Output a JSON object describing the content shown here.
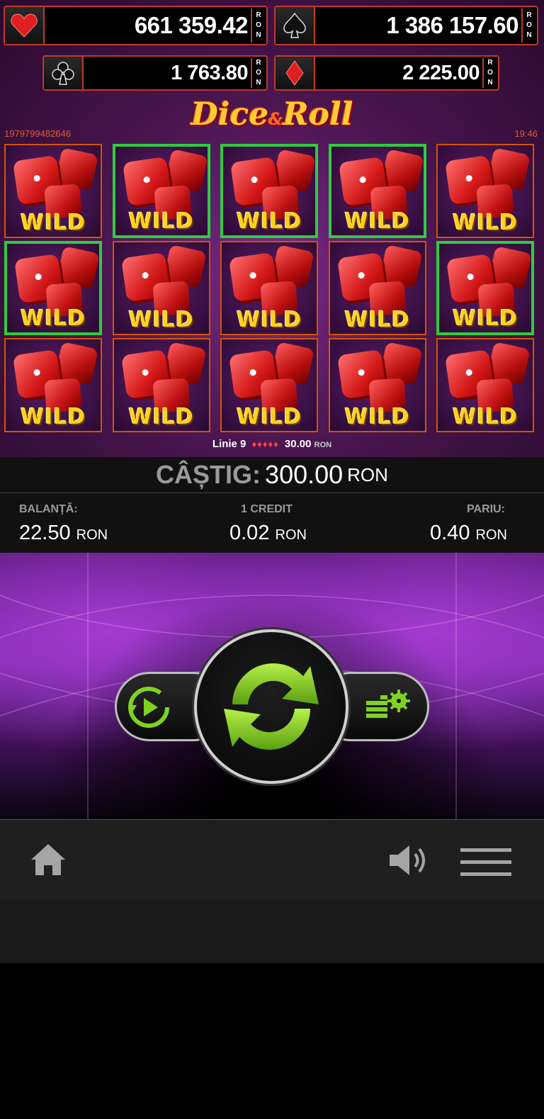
{
  "jackpots": [
    {
      "suit": "heart-icon",
      "amount": "661 359.42",
      "currency": "RON",
      "color": "#e02020"
    },
    {
      "suit": "spade-icon",
      "amount": "1 386 157.60",
      "currency": "RON",
      "color": "#111111"
    },
    {
      "suit": "club-icon",
      "amount": "1 763.80",
      "currency": "RON",
      "color": "#111111"
    },
    {
      "suit": "diamond-icon",
      "amount": "2 225.00",
      "currency": "RON",
      "color": "#e02020"
    }
  ],
  "game": {
    "title_part1": "Dice",
    "title_amp": "&",
    "title_part2": "Roll",
    "round_id": "1979799482646",
    "time": "19:46",
    "symbol_label": "WILD",
    "rows": 3,
    "columns": 5,
    "winning_cells": [
      [
        0,
        1
      ],
      [
        0,
        2
      ],
      [
        0,
        3
      ],
      [
        1,
        0
      ],
      [
        1,
        4
      ]
    ],
    "win_line": {
      "label": "Linie 9",
      "amount": "30.00",
      "currency": "RON",
      "symbol_count": 5
    }
  },
  "win": {
    "label": "CÂȘTIG:",
    "value": "300.00",
    "currency": "RON"
  },
  "stats": {
    "balance": {
      "label": "BALANȚĂ:",
      "value": "22.50",
      "currency": "RON"
    },
    "credit": {
      "label": "1 CREDIT",
      "value": "0.02",
      "currency": "RON"
    },
    "bet": {
      "label": "PARIU:",
      "value": "0.40",
      "currency": "RON"
    }
  },
  "controls": {
    "autoplay_icon": "autoplay-icon",
    "spin_icon": "spin-icon",
    "bet_settings_icon": "bet-settings-icon",
    "accent": "#7ed321"
  },
  "nav": {
    "home_icon": "home-icon",
    "sound_icon": "speaker-icon",
    "menu_icon": "hamburger-menu-icon"
  }
}
